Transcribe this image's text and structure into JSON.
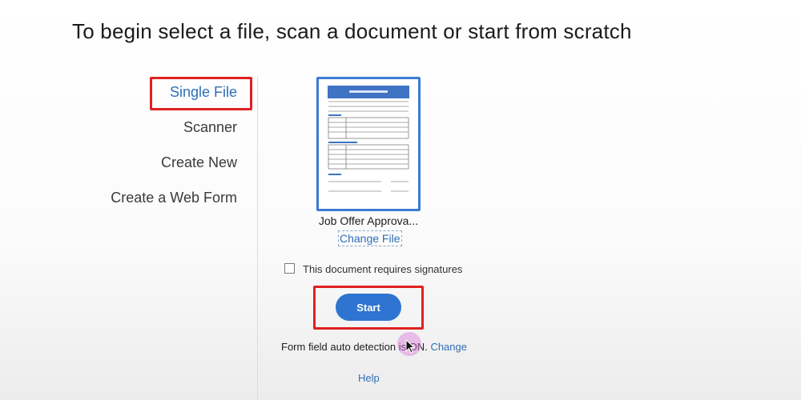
{
  "page": {
    "heading": "To begin select a file, scan a document or start from scratch"
  },
  "sidebar": {
    "items": [
      {
        "label": "Single File",
        "active": true
      },
      {
        "label": "Scanner",
        "active": false
      },
      {
        "label": "Create New",
        "active": false
      },
      {
        "label": "Create a Web Form",
        "active": false
      }
    ]
  },
  "file": {
    "name": "Job Offer Approva...",
    "change_label": "Change File"
  },
  "signature": {
    "label": "This document requires signatures",
    "checked": false
  },
  "start": {
    "label": "Start"
  },
  "auto_detect": {
    "text": "Form field auto detection is ON.",
    "change_label": "Change"
  },
  "help": {
    "label": "Help"
  },
  "colors": {
    "accent": "#2f74d0",
    "highlight_box": "#e02020",
    "link": "#2f6fb6"
  },
  "icons": {
    "document_thumbnail": "document-thumbnail-icon",
    "mouse_cursor": "mouse-cursor-icon"
  }
}
